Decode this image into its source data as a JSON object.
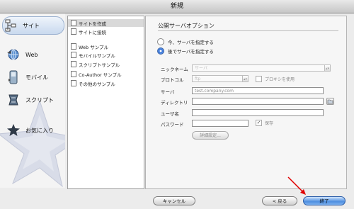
{
  "window": {
    "title": "新規"
  },
  "categories": [
    {
      "label": "サイト",
      "icon": "site-icon",
      "selected": true
    },
    {
      "label": "Web",
      "icon": "web-globe-icon"
    },
    {
      "label": "モバイル",
      "icon": "mobile-phone-icon"
    },
    {
      "label": "スクリプト",
      "icon": "script-icon"
    },
    {
      "label": "お気に入り",
      "icon": "favorites-icon"
    }
  ],
  "sub_items": [
    {
      "label": "サイトを作成",
      "selected": true
    },
    {
      "label": "サイトに接続"
    },
    {
      "label": "Web サンプル"
    },
    {
      "label": "モバイルサンプル"
    },
    {
      "label": "スクリプトサンプル"
    },
    {
      "label": "Co-Author サンプル"
    },
    {
      "label": "その他のサンプル"
    }
  ],
  "panel": {
    "heading": "公開サーバオプション",
    "radio_now": "今、サーバを指定する",
    "radio_later": "後でサーバを指定する",
    "radio_selected": "later",
    "nickname_label": "ニックネーム",
    "nickname_value": "サーバ",
    "protocol_label": "プロトコル",
    "protocol_value": "ftp",
    "proxy_label": "プロキシを使用",
    "server_label": "サーバ",
    "server_placeholder": "test.company.com",
    "directory_label": "ディレクトリ",
    "username_label": "ユーザ名",
    "password_label": "パスワード",
    "save_label": "保存",
    "save_checked": true,
    "details_button": "詳細設定..."
  },
  "buttons": {
    "cancel": "キャンセル",
    "back": "< 戻る",
    "finish": "終了"
  },
  "colors": {
    "accent": "#4e8fe0",
    "annotation_arrow": "#e00000"
  }
}
